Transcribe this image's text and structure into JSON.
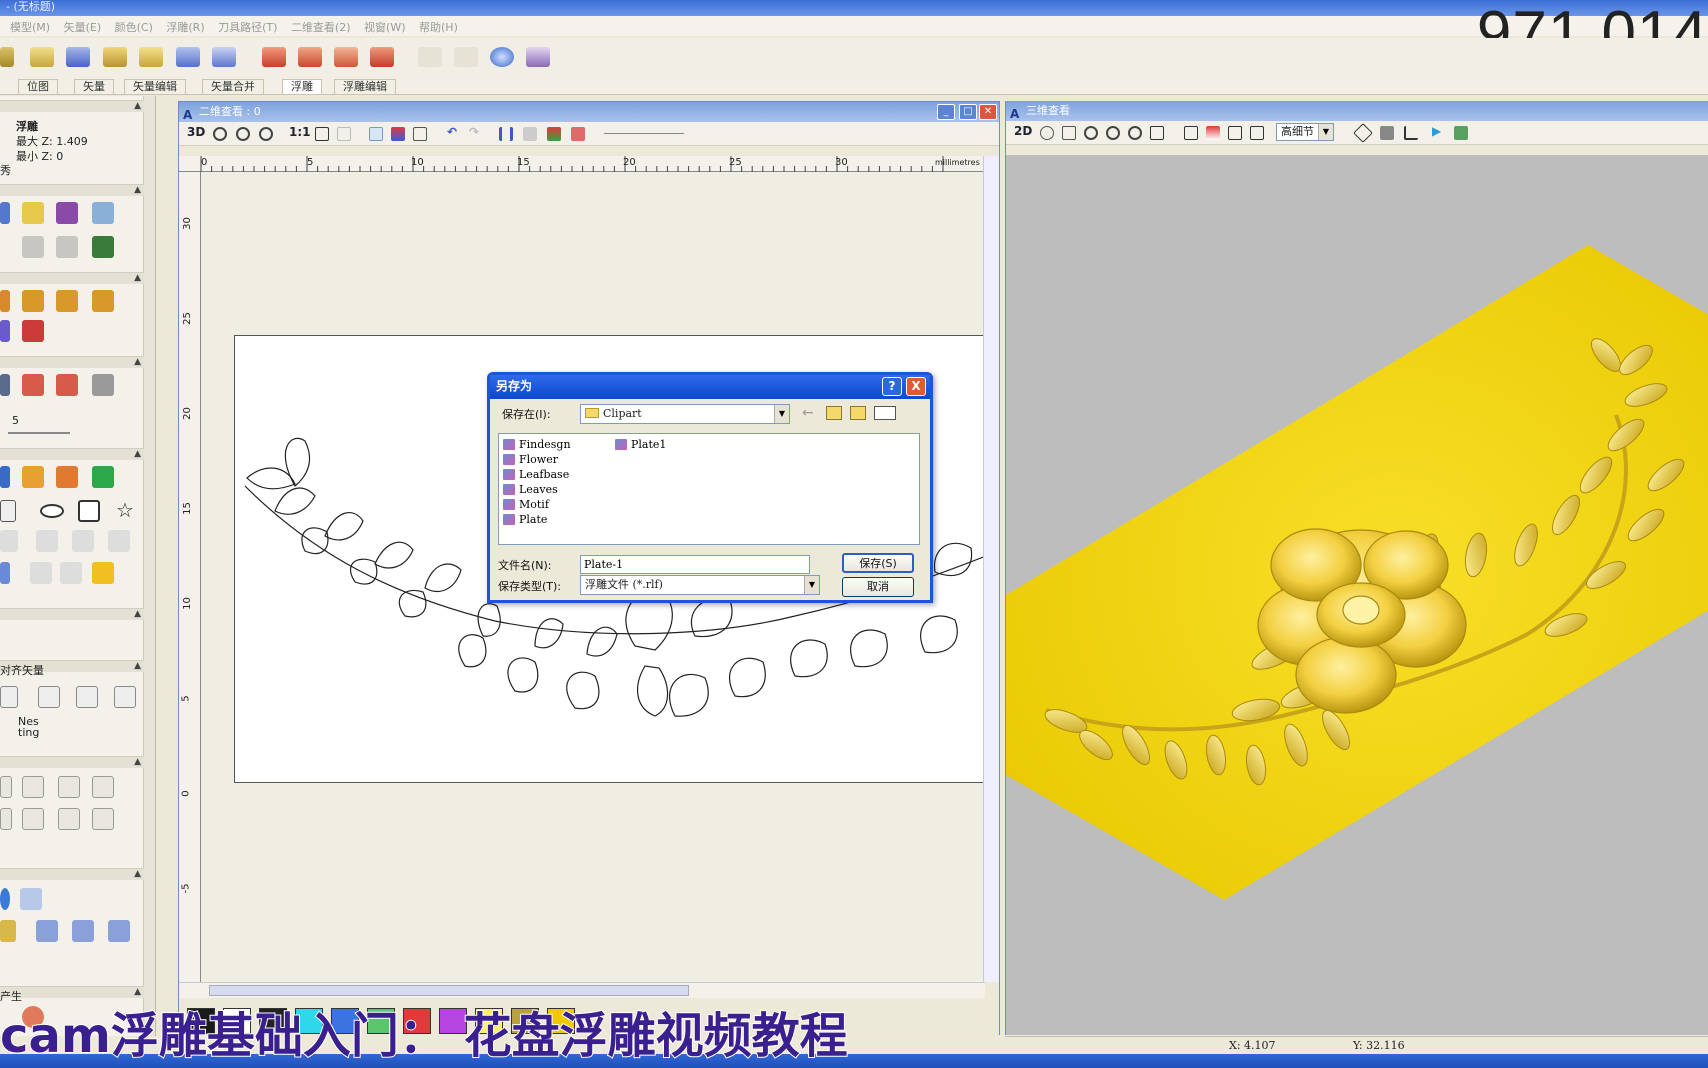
{
  "app": {
    "title": "- (无标题)"
  },
  "watermark": "971 014",
  "menu": [
    "模型(M)",
    "矢量(E)",
    "颜色(C)",
    "浮雕(R)",
    "刀具路径(T)",
    "二维查看(2)",
    "视窗(W)",
    "帮助(H)"
  ],
  "tabs": [
    "位图",
    "矢量",
    "矢量编辑",
    "矢量合并",
    "浮雕",
    "浮雕编辑"
  ],
  "active_tab": "浮雕",
  "left_panel": {
    "relief_title": "浮雕",
    "max_z": "最大  Z: 1.409",
    "min_z": "最小  Z: 0",
    "partial_label": "秀",
    "size_label": "5",
    "align_title": "对齐矢量",
    "nesting_label": "Nes\nting",
    "generate_label": "产生"
  },
  "view2d": {
    "title": "二维查看 : 0",
    "btn_3d": "3D",
    "btn_1to1": "1:1",
    "ruler_unit": "millimetres",
    "ruler_top_ticks": [
      "0",
      "5",
      "10",
      "15",
      "20",
      "25",
      "30"
    ],
    "ruler_left_ticks": [
      "30",
      "25",
      "20",
      "15",
      "10",
      "5",
      "0",
      "-5"
    ],
    "palette": [
      "#1a1a1a",
      "#ffffff",
      "#222222",
      "#2ed8e8",
      "#3b73e0",
      "#5cc46a",
      "#e03a3a",
      "#b544e0",
      "#fff06a",
      "#b9a040",
      "#f0c800"
    ]
  },
  "view3d": {
    "title": "三维查看",
    "btn_2d": "2D",
    "detail_select": "高细节",
    "surface_color": "#f5d800"
  },
  "dialog": {
    "title": "另存为",
    "help": "?",
    "close": "X",
    "save_in_label": "保存在(I):",
    "save_in_value": "Clipart",
    "files_col1": [
      "Findesgn",
      "Flower",
      "Leafbase",
      "Leaves",
      "Motif",
      "Plate"
    ],
    "files_col2": [
      "Plate1"
    ],
    "filename_label": "文件名(N):",
    "filename_value": "Plate-1",
    "filetype_label": "保存类型(T):",
    "filetype_value": "浮雕文件 (*.rlf)",
    "save_button": "保存(S)",
    "cancel_button": "取消"
  },
  "status": {
    "x": "X: 4.107",
    "y": "Y: 32.116"
  },
  "subtitle": "cam浮雕基础入门：  花盘浮雕视频教程"
}
